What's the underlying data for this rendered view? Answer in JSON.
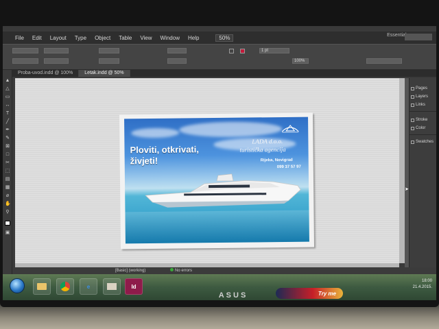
{
  "app": {
    "logo": "Id",
    "menu": [
      "File",
      "Edit",
      "Layout",
      "Type",
      "Object",
      "Table",
      "View",
      "Window",
      "Help"
    ],
    "zoom": "50%",
    "workspace": "Essentials"
  },
  "control_panel": {
    "stroke_weight": "1 pt",
    "opacity": "100%"
  },
  "tabs": [
    {
      "label": "Proba-uvod.indd @ 100%",
      "active": false
    },
    {
      "label": "Letak.indd @ 50%",
      "active": true
    }
  ],
  "flyer": {
    "headline_line1": "Ploviti, otkrivati,",
    "headline_line2": "živjeti!",
    "company_name": "LADA d.o.o.",
    "company_tagline": "turistička agencija",
    "address": "Rijeka, Novigrad",
    "phone": "099 37 57 97"
  },
  "panels": [
    {
      "label": "Pages",
      "icon": "pages-icon"
    },
    {
      "label": "Layers",
      "icon": "layers-icon"
    },
    {
      "label": "Links",
      "icon": "links-icon"
    },
    {
      "label": "Stroke",
      "icon": "stroke-icon"
    },
    {
      "label": "Color",
      "icon": "color-icon"
    },
    {
      "label": "Swatches",
      "icon": "swatches-icon"
    }
  ],
  "status": {
    "style": "[Basic] (working)",
    "errors": "No errors"
  },
  "taskbar": {
    "app_label": "Id",
    "clock": "18:00",
    "date": "21.4.2015."
  },
  "monitor": {
    "brand": "ASUS",
    "sticker": "Try me"
  },
  "colors": {
    "indesign_accent": "#c21a3a",
    "sea_blue": "#1d8fc1",
    "sky_blue": "#4d93de"
  }
}
